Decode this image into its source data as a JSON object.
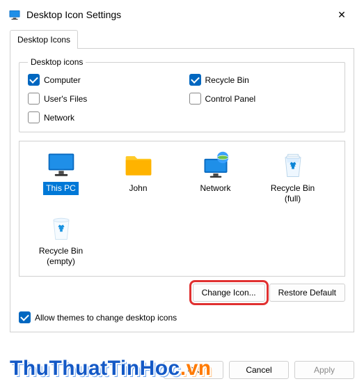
{
  "window": {
    "title": "Desktop Icon Settings",
    "close_glyph": "✕"
  },
  "tab": {
    "label": "Desktop Icons"
  },
  "group": {
    "legend": "Desktop icons",
    "items": [
      {
        "key": "computer",
        "label": "Computer",
        "checked": true
      },
      {
        "key": "recyclebin",
        "label": "Recycle Bin",
        "checked": true
      },
      {
        "key": "usersfiles",
        "label": "User's Files",
        "checked": false
      },
      {
        "key": "controlpanel",
        "label": "Control Panel",
        "checked": false
      },
      {
        "key": "network",
        "label": "Network",
        "checked": false
      }
    ]
  },
  "icons": [
    {
      "key": "thispc",
      "label": "This PC",
      "selected": true
    },
    {
      "key": "john",
      "label": "John",
      "selected": false
    },
    {
      "key": "network",
      "label": "Network",
      "selected": false
    },
    {
      "key": "recycle-full",
      "label": "Recycle Bin (full)",
      "selected": false
    },
    {
      "key": "recycle-empty",
      "label": "Recycle Bin (empty)",
      "selected": false
    }
  ],
  "buttons": {
    "change_icon": "Change Icon...",
    "restore_default": "Restore Default",
    "ok": "OK",
    "cancel": "Cancel",
    "apply": "Apply"
  },
  "allow_themes": {
    "label": "Allow themes to change desktop icons",
    "checked": true
  },
  "watermark": {
    "part1": "ThuThuatTinHoc",
    "part2": ".vn"
  },
  "colors": {
    "accent": "#0067c0",
    "selection": "#0078d7",
    "highlight": "#e03030"
  }
}
